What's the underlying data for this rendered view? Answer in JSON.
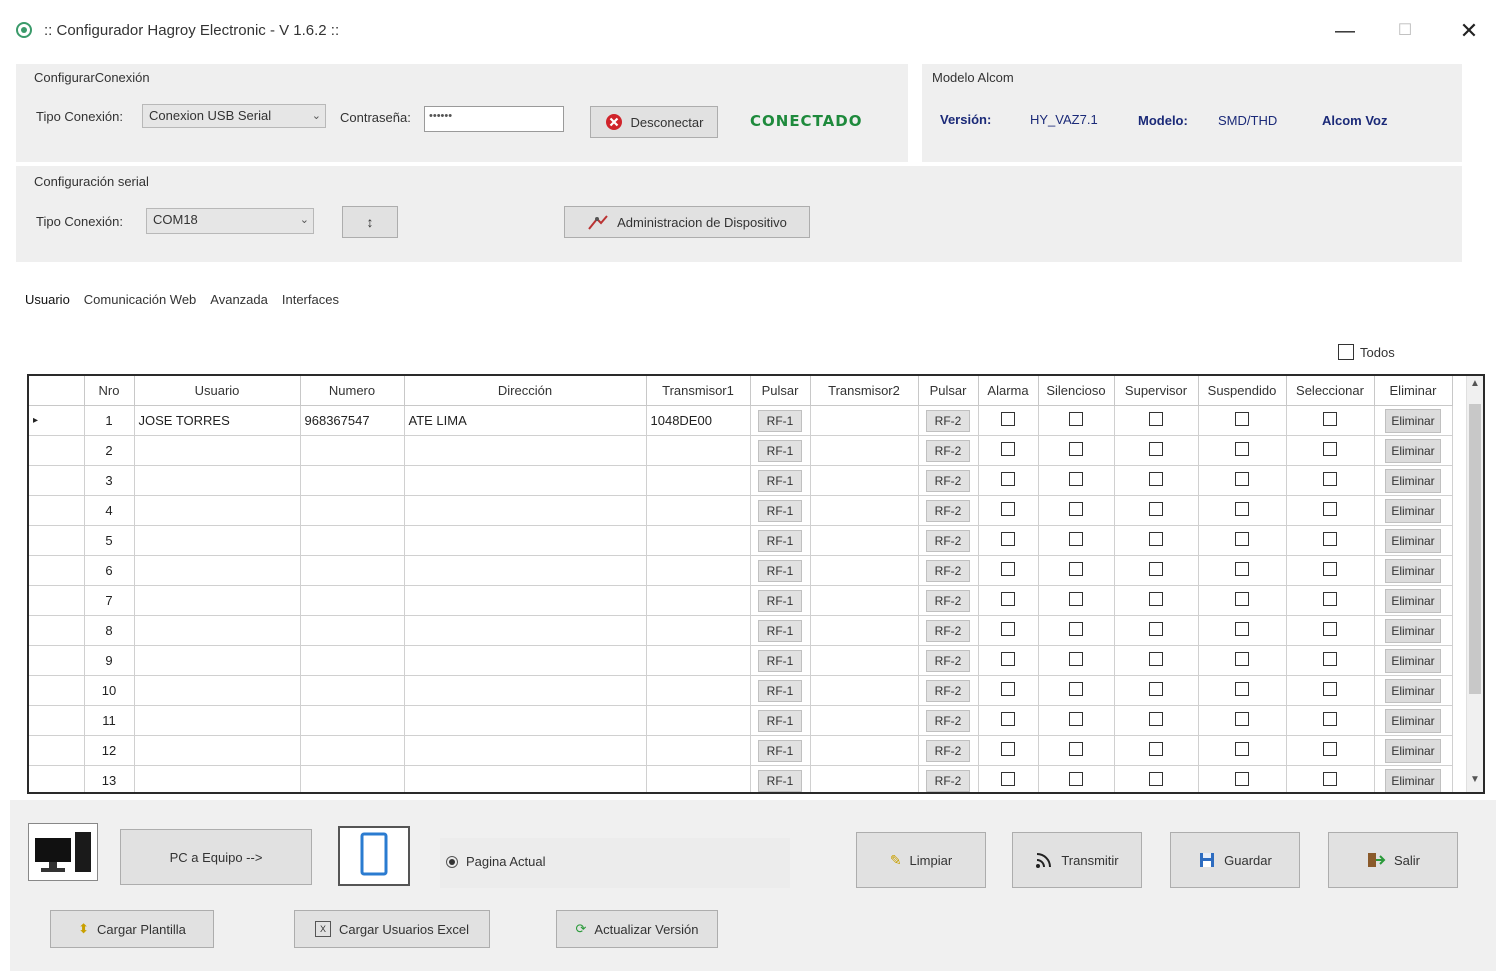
{
  "window": {
    "title": ":: Configurador Hagroy Electronic - V 1.6.2 ::",
    "minimize": "—",
    "maximize": "☐",
    "close": "✕"
  },
  "connection": {
    "group_title": "ConfigurarConexión",
    "type_label": "Tipo Conexión:",
    "type_value": "Conexion USB Serial",
    "password_label": "Contraseña:",
    "password_value": "••••••",
    "disconnect_label": "Desconectar",
    "status": "CONECTADO"
  },
  "model": {
    "group_title": "Modelo Alcom",
    "version_label": "Versión:",
    "version_value": "HY_VAZ7.1",
    "model_label": "Modelo:",
    "model_value": "SMD/THD",
    "brand": "Alcom Voz"
  },
  "serial": {
    "group_title": "Configuración serial",
    "type_label": "Tipo Conexión:",
    "port_value": "COM18",
    "refresh_label": "↕",
    "admin_label": "Administracion de Dispositivo"
  },
  "tabs": [
    {
      "label": "Usuario"
    },
    {
      "label": "Comunicación Web"
    },
    {
      "label": "Avanzada"
    },
    {
      "label": "Interfaces"
    }
  ],
  "select_all_label": "Todos",
  "grid": {
    "columns": [
      "Nro",
      "Usuario",
      "Numero",
      "Dirección",
      "Transmisor1",
      "Pulsar",
      "Transmisor2",
      "Pulsar",
      "Alarma",
      "Silencioso",
      "Supervisor",
      "Suspendido",
      "Seleccionar",
      "Eliminar"
    ],
    "rf1_label": "RF-1",
    "rf2_label": "RF-2",
    "delete_label": "Eliminar",
    "current_row_marker": "▸",
    "rows": [
      {
        "nro": "1",
        "usuario": "JOSE TORRES",
        "numero": "968367547",
        "direccion": "ATE LIMA",
        "transmisor1": "1048DE00",
        "transmisor2": ""
      },
      {
        "nro": "2",
        "usuario": "",
        "numero": "",
        "direccion": "",
        "transmisor1": "",
        "transmisor2": ""
      },
      {
        "nro": "3",
        "usuario": "",
        "numero": "",
        "direccion": "",
        "transmisor1": "",
        "transmisor2": ""
      },
      {
        "nro": "4",
        "usuario": "",
        "numero": "",
        "direccion": "",
        "transmisor1": "",
        "transmisor2": ""
      },
      {
        "nro": "5",
        "usuario": "",
        "numero": "",
        "direccion": "",
        "transmisor1": "",
        "transmisor2": ""
      },
      {
        "nro": "6",
        "usuario": "",
        "numero": "",
        "direccion": "",
        "transmisor1": "",
        "transmisor2": ""
      },
      {
        "nro": "7",
        "usuario": "",
        "numero": "",
        "direccion": "",
        "transmisor1": "",
        "transmisor2": ""
      },
      {
        "nro": "8",
        "usuario": "",
        "numero": "",
        "direccion": "",
        "transmisor1": "",
        "transmisor2": ""
      },
      {
        "nro": "9",
        "usuario": "",
        "numero": "",
        "direccion": "",
        "transmisor1": "",
        "transmisor2": ""
      },
      {
        "nro": "10",
        "usuario": "",
        "numero": "",
        "direccion": "",
        "transmisor1": "",
        "transmisor2": ""
      },
      {
        "nro": "11",
        "usuario": "",
        "numero": "",
        "direccion": "",
        "transmisor1": "",
        "transmisor2": ""
      },
      {
        "nro": "12",
        "usuario": "",
        "numero": "",
        "direccion": "",
        "transmisor1": "",
        "transmisor2": ""
      },
      {
        "nro": "13",
        "usuario": "",
        "numero": "",
        "direccion": "",
        "transmisor1": "",
        "transmisor2": ""
      }
    ]
  },
  "bottom": {
    "pc_to_device_label": "PC a Equipo -->",
    "current_page_label": "Pagina Actual",
    "clear_label": "Limpiar",
    "transmit_label": "Transmitir",
    "save_label": "Guardar",
    "exit_label": "Salir",
    "load_template_label": "Cargar Plantilla",
    "load_excel_label": "Cargar Usuarios Excel",
    "update_version_label": "Actualizar Versión"
  },
  "colors": {
    "status_green": "#1e8a3c",
    "info_blue": "#1b2a78",
    "panel_gray": "#efefef"
  }
}
